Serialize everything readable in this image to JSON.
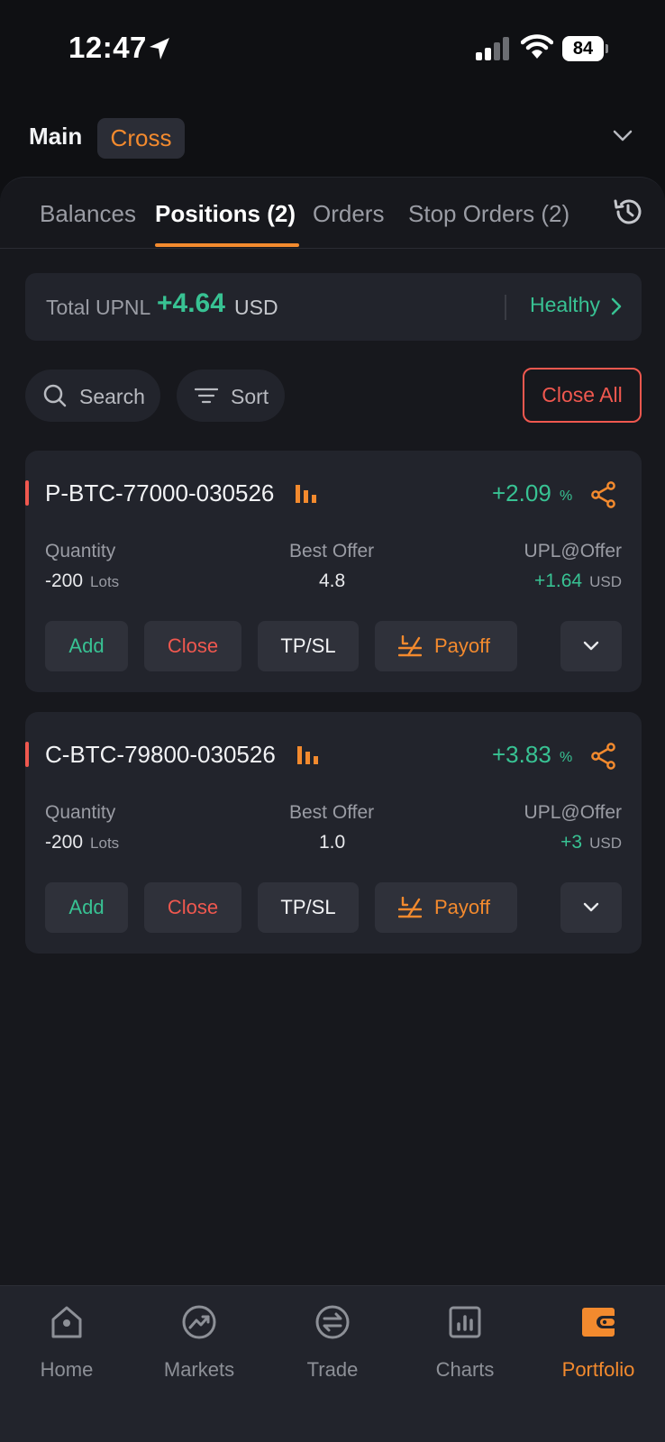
{
  "status_bar": {
    "time": "12:47",
    "battery": "84"
  },
  "account": {
    "name": "Main",
    "mode": "Cross"
  },
  "tabs": [
    {
      "label": "Balances"
    },
    {
      "label": "Positions (2)"
    },
    {
      "label": "Orders"
    },
    {
      "label": "Stop Orders (2)"
    }
  ],
  "upnl": {
    "label": "Total UPNL",
    "value": "+4.64",
    "unit": "USD",
    "health": "Healthy"
  },
  "filters": {
    "search_label": "Search",
    "sort_label": "Sort",
    "close_all_label": "Close All"
  },
  "positions": [
    {
      "symbol": "P-BTC-77000-030526",
      "pnl_pct": "+2.09",
      "pct_sign": "%",
      "quantity_label": "Quantity",
      "quantity": "-200",
      "quantity_unit": "Lots",
      "best_offer_label": "Best Offer",
      "best_offer": "4.8",
      "upl_label": "UPL@Offer",
      "upl": "+1.64",
      "upl_unit": "USD",
      "buttons": {
        "add": "Add",
        "close": "Close",
        "tpsl": "TP/SL",
        "payoff": "Payoff"
      }
    },
    {
      "symbol": "C-BTC-79800-030526",
      "pnl_pct": "+3.83",
      "pct_sign": "%",
      "quantity_label": "Quantity",
      "quantity": "-200",
      "quantity_unit": "Lots",
      "best_offer_label": "Best Offer",
      "best_offer": "1.0",
      "upl_label": "UPL@Offer",
      "upl": "+3",
      "upl_unit": "USD",
      "buttons": {
        "add": "Add",
        "close": "Close",
        "tpsl": "TP/SL",
        "payoff": "Payoff"
      }
    }
  ],
  "nav": [
    {
      "label": "Home",
      "icon": "home-icon"
    },
    {
      "label": "Markets",
      "icon": "markets-icon"
    },
    {
      "label": "Trade",
      "icon": "trade-icon"
    },
    {
      "label": "Charts",
      "icon": "charts-icon"
    },
    {
      "label": "Portfolio",
      "icon": "wallet-icon",
      "active": true
    }
  ],
  "colors": {
    "accent": "#f38a2e",
    "positive": "#38c293",
    "negative": "#f0584f",
    "background": "#0f1013",
    "card": "#22242c"
  }
}
